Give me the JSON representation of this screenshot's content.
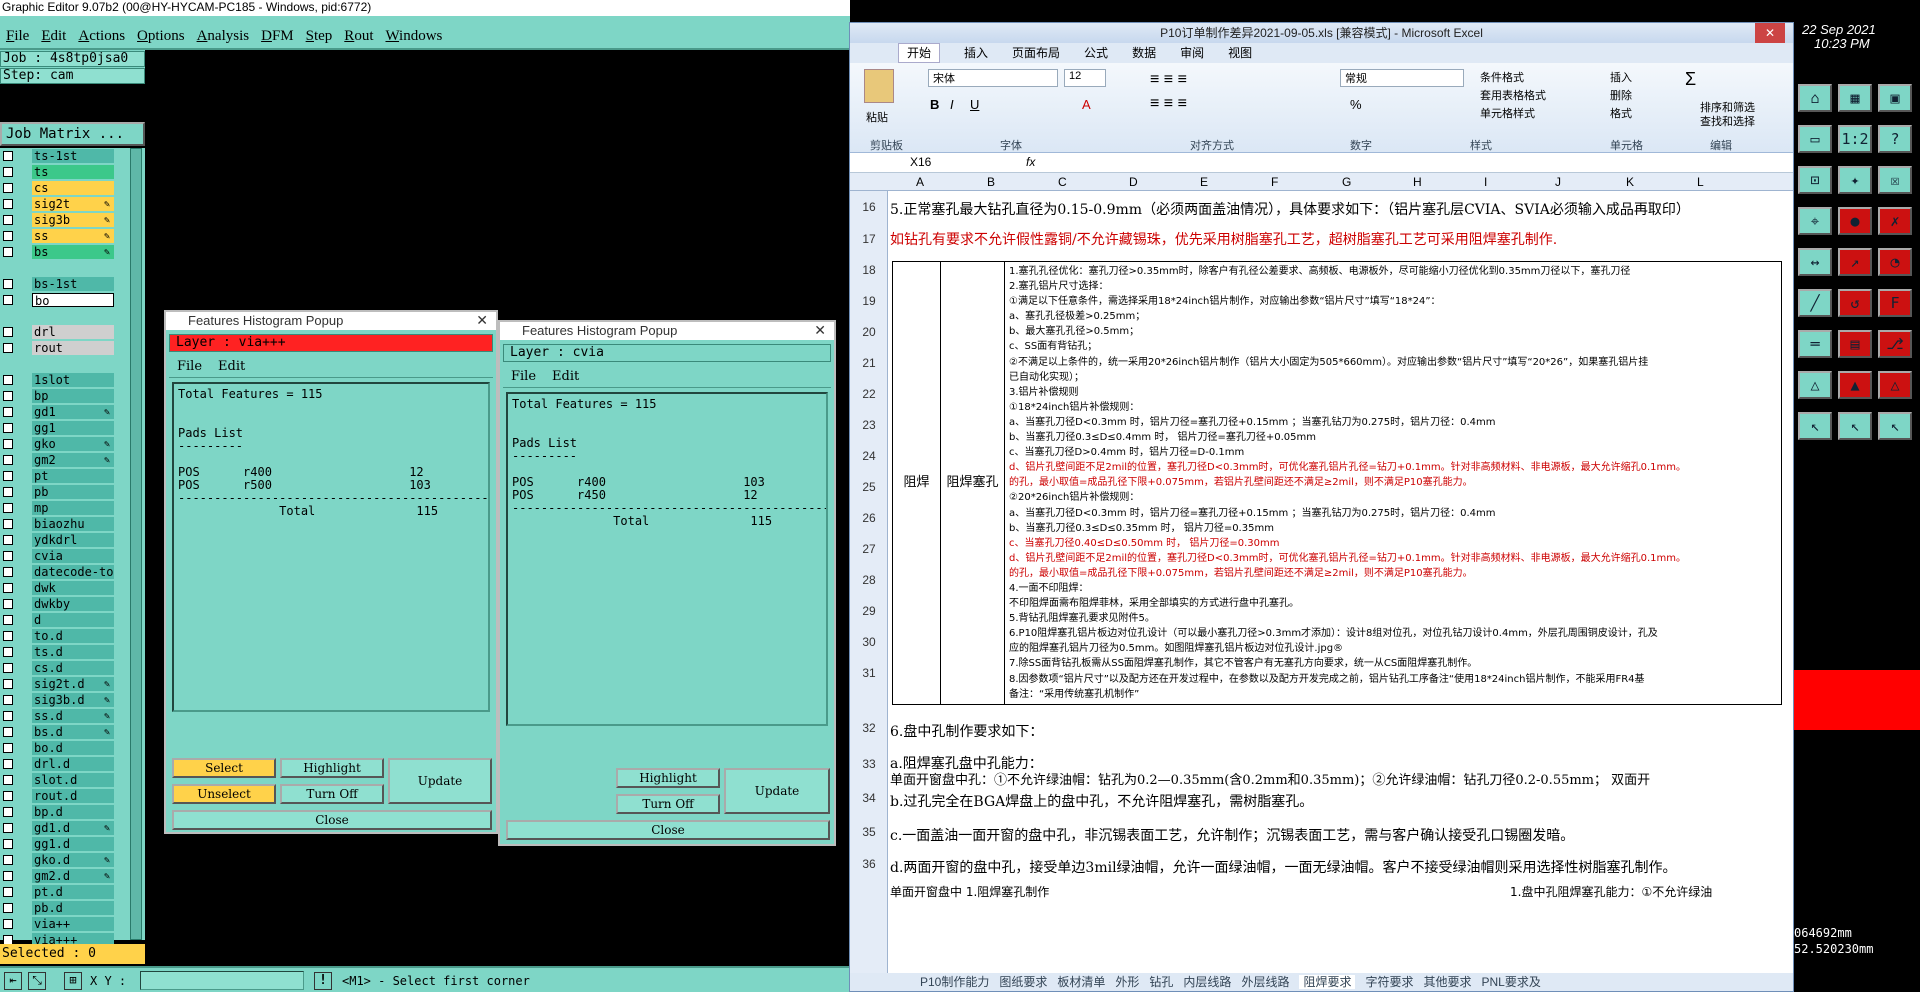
{
  "app": {
    "title": "Graphic Editor 9.07b2 (00@HY-HYCAM-PC185 - Windows, pid:6772)",
    "menu": [
      "File",
      "Edit",
      "Actions",
      "Options",
      "Analysis",
      "DFM",
      "Step",
      "Rout",
      "Windows"
    ],
    "job_label": "Job : 4s8tp0jsa0",
    "step_label": "Step: cam",
    "job_matrix": "Job Matrix ...",
    "selected": "Selected : 0",
    "xy_label": "X Y :",
    "status_msg": "<M1> - Select first corner",
    "coord1": "064692mm",
    "coord2": "52.520230mm",
    "date": "22 Sep 2021",
    "time": "10:23 PM"
  },
  "layers": [
    {
      "name": "ts-1st",
      "style": "teal2"
    },
    {
      "name": "ts",
      "style": "green"
    },
    {
      "name": "cs",
      "style": "yellow"
    },
    {
      "name": "sig2t",
      "style": "yellow",
      "flag": "✎"
    },
    {
      "name": "sig3b",
      "style": "yellow",
      "flag": "✎"
    },
    {
      "name": "ss",
      "style": "yellow",
      "flag": "✎"
    },
    {
      "name": "bs",
      "style": "green",
      "flag": "✎"
    },
    {
      "name": "",
      "style": "none"
    },
    {
      "name": "bs-1st",
      "style": "teal2"
    },
    {
      "name": "bo",
      "style": "white"
    },
    {
      "name": "",
      "style": "none"
    },
    {
      "name": "drl",
      "style": "gray"
    },
    {
      "name": "rout",
      "style": "gray"
    },
    {
      "name": "",
      "style": "none"
    },
    {
      "name": "1slot",
      "style": "teal2"
    },
    {
      "name": "bp",
      "style": "teal2"
    },
    {
      "name": "gd1",
      "style": "teal2",
      "flag": "✎"
    },
    {
      "name": "gg1",
      "style": "teal2"
    },
    {
      "name": "gko",
      "style": "teal2",
      "flag": "✎"
    },
    {
      "name": "gm2",
      "style": "teal2",
      "flag": "✎"
    },
    {
      "name": "pt",
      "style": "teal2"
    },
    {
      "name": "pb",
      "style": "teal2"
    },
    {
      "name": "mp",
      "style": "teal2"
    },
    {
      "name": "biaozhu",
      "style": "teal2"
    },
    {
      "name": "ydkdrl",
      "style": "teal2"
    },
    {
      "name": "cvia",
      "style": "teal2"
    },
    {
      "name": "datecode-to",
      "style": "teal2"
    },
    {
      "name": "dwk",
      "style": "teal2"
    },
    {
      "name": "dwkby",
      "style": "teal2"
    },
    {
      "name": "d",
      "style": "teal2"
    },
    {
      "name": "to.d",
      "style": "teal2"
    },
    {
      "name": "ts.d",
      "style": "teal2"
    },
    {
      "name": "cs.d",
      "style": "teal2"
    },
    {
      "name": "sig2t.d",
      "style": "teal2",
      "flag": "✎"
    },
    {
      "name": "sig3b.d",
      "style": "teal2",
      "flag": "✎"
    },
    {
      "name": "ss.d",
      "style": "teal2",
      "flag": "✎"
    },
    {
      "name": "bs.d",
      "style": "teal2",
      "flag": "✎"
    },
    {
      "name": "bo.d",
      "style": "teal2"
    },
    {
      "name": "drl.d",
      "style": "teal2"
    },
    {
      "name": "slot.d",
      "style": "teal2"
    },
    {
      "name": "rout.d",
      "style": "teal2"
    },
    {
      "name": "bp.d",
      "style": "teal2"
    },
    {
      "name": "gd1.d",
      "style": "teal2",
      "flag": "✎"
    },
    {
      "name": "gg1.d",
      "style": "teal2"
    },
    {
      "name": "gko.d",
      "style": "teal2",
      "flag": "✎"
    },
    {
      "name": "gm2.d",
      "style": "teal2",
      "flag": "✎"
    },
    {
      "name": "pt.d",
      "style": "teal2"
    },
    {
      "name": "pb.d",
      "style": "teal2"
    },
    {
      "name": "via++",
      "style": "teal2"
    },
    {
      "name": "via+++",
      "style": "teal2"
    }
  ],
  "popup1": {
    "title": "Features Histogram Popup",
    "layer": "Layer :  via+++",
    "menu": [
      "File",
      "Edit"
    ],
    "text": "Total Features = 115\n\n\nPads List\n---------\n\nPOS      r400                   12\nPOS      r500                   103\n-----------------------------------------------\n              Total              115",
    "select": "Select",
    "unselect": "Unselect",
    "highlight": "Highlight",
    "turn_off": "Turn Off",
    "update": "Update",
    "close": "Close"
  },
  "popup2": {
    "title": "Features Histogram Popup",
    "layer": "Layer :  cvia",
    "menu": [
      "File",
      "Edit"
    ],
    "text": "Total Features = 115\n\n\nPads List\n---------\n\nPOS      r400                   103\nPOS      r450                   12\n-----------------------------------------------\n              Total              115",
    "highlight": "Highlight",
    "turn_off": "Turn Off",
    "update": "Update",
    "close": "Close"
  },
  "excel": {
    "title": "P10订单制作差异2021-09-05.xls  [兼容模式] - Microsoft Excel",
    "tabs": [
      "开始",
      "插入",
      "页面布局",
      "公式",
      "数据",
      "审阅",
      "视图"
    ],
    "font": "宋体",
    "size": "12",
    "numfmt": "常规",
    "groups": [
      "剪贴板",
      "字体",
      "对齐方式",
      "数字",
      "样式",
      "单元格",
      "编辑"
    ],
    "paste": "粘贴",
    "style_btns": [
      "条件格式",
      "套用表格格式",
      "单元格样式"
    ],
    "cell_btns": [
      "插入",
      "删除",
      "格式"
    ],
    "edit_btns": [
      "排序和筛选",
      "查找和选择"
    ],
    "namebox": "X16",
    "fx": "fx",
    "columns": [
      "A",
      "B",
      "C",
      "D",
      "E",
      "F",
      "G",
      "H",
      "I",
      "J",
      "K",
      "L"
    ],
    "rows": [
      {
        "n": "16",
        "text": "5.正常塞孔最大钻孔直径为0.15-0.9mm（必须两面盖油情况），具体要求如下：（铝片塞孔层CVIA、SVIA必须输入成品再取印）",
        "color": "#000"
      },
      {
        "n": "17",
        "text": "如钻孔有要求不允许假性露铜/不允许藏锡珠，优先采用树脂塞孔工艺，超树脂塞孔工艺可采用阻焊塞孔制作.",
        "color": "#c00"
      }
    ],
    "row_nums_block": [
      "18",
      "19",
      "20",
      "21",
      "22",
      "23",
      "24",
      "25",
      "26",
      "27",
      "28",
      "29",
      "30",
      "31"
    ],
    "block_a": "阻焊",
    "block_b": "阻焊塞孔",
    "block_lines": [
      {
        "t": "1.塞孔孔径优化：塞孔刀径>0.35mm时，除客户有孔径公差要求、高频板、电源板外，尽可能缩小刀径优化到0.35mm刀径以下，塞孔刀径",
        "c": "#000"
      },
      {
        "t": "2.塞孔铝片尺寸选择：",
        "c": "#000"
      },
      {
        "t": "①满足以下任意条件，需选择采用18*24inch铝片制作，对应输出参数“铝片尺寸”填写“18*24”：",
        "c": "#000"
      },
      {
        "t": "a、塞孔孔径极差>0.25mm；",
        "c": "#000"
      },
      {
        "t": "b、最大塞孔孔径>0.5mm；",
        "c": "#000"
      },
      {
        "t": "c、SS面有背钻孔；",
        "c": "#000"
      },
      {
        "t": "②不满足以上条件的，统一采用20*26inch铝片制作（铝片大小固定为505*660mm）。对应输出参数“铝片尺寸”填写“20*26”，如果塞孔铝片挂",
        "c": "#000"
      },
      {
        "t": "已自动化实现）；",
        "c": "#000"
      },
      {
        "t": "3.铝片补偿规则",
        "c": "#000"
      },
      {
        "t": "①18*24inch铝片补偿规则：",
        "c": "#000"
      },
      {
        "t": "a、当塞孔刀径D<0.3mm 时，铝片刀径=塞孔刀径+0.15mm ；当塞孔钻刀为0.275时，铝片刀径：0.4mm",
        "c": "#000"
      },
      {
        "t": "b、当塞孔刀径0.3≤D≤0.4mm 时，  铝片刀径=塞孔刀径+0.05mm",
        "c": "#000"
      },
      {
        "t": "c、当塞孔刀径D>0.4mm 时，铝片刀径=D-0.1mm",
        "c": "#000"
      },
      {
        "t": "d、铝片孔壁间距不足2mil的位置，塞孔刀径D<0.3mm时，可优化塞孔铝片孔径=钻刀+0.1mm。针对非高频材料、非电源板，最大允许缩孔0.1mm。",
        "c": "#c00"
      },
      {
        "t": "的孔，最小取值=成品孔径下限+0.075mm，若铝片孔壁间距还不满足≥2mil，则不满足P10塞孔能力。",
        "c": "#c00"
      },
      {
        "t": "②20*26inch铝片补偿规则：",
        "c": "#000"
      },
      {
        "t": "a、当塞孔刀径D<0.3mm 时，铝片刀径=塞孔刀径+0.15mm ；当塞孔钻刀为0.275时，铝片刀径：0.4mm",
        "c": "#000"
      },
      {
        "t": "b、当塞孔刀径0.3≤D≤0.35mm 时，  铝片刀径=0.35mm",
        "c": "#000"
      },
      {
        "t": "c、当塞孔刀径0.40≤D≤0.50mm 时，  铝片刀径=0.30mm",
        "c": "#c00"
      },
      {
        "t": "d、铝片孔壁间距不足2mil的位置，塞孔刀径D<0.3mm时，可优化塞孔铝片孔径=钻刀+0.1mm。针对非高频材料、非电源板，最大允许缩孔0.1mm。",
        "c": "#c00"
      },
      {
        "t": "的孔，最小取值=成品孔径下限+0.075mm，若铝片孔壁间距还不满足≥2mil，则不满足P10塞孔能力。",
        "c": "#c00"
      },
      {
        "t": "4.一面不印阻焊：",
        "c": "#000"
      },
      {
        "t": "不印阻焊面需布阻焊菲林，采用全部填实的方式进行盘中孔塞孔。",
        "c": "#000"
      },
      {
        "t": "5.背钻孔阻焊塞孔要求见附件5。",
        "c": "#000"
      },
      {
        "t": "6.P10阻焊塞孔铝片板边对位孔设计（可以最小塞孔刀径>0.3mm才添加）：设计8组对位孔，对位孔钻刀设计0.4mm，外层孔周围铜皮设计，孔及",
        "c": "#000"
      },
      {
        "t": "应的阻焊塞孔铝片刀径为0.5mm。如图阻焊塞孔铝片板边对位孔设计.jpg®",
        "c": "#000"
      },
      {
        "t": "7.除SS面背钻孔板需从SS面阻焊塞孔制作，其它不管客户有无塞孔方向要求，统一从CS面阻焊塞孔制作。",
        "c": "#000"
      },
      {
        "t": "8.因参数项“铝片尺寸”以及配方还在开发过程中，在参数以及配方开发完成之前，铝片钻孔工序备注“使用18*24inch铝片制作，不能采用FR4基",
        "c": "#000"
      },
      {
        "t": "备注：“采用传统塞孔机制作”",
        "c": "#000"
      }
    ],
    "rows_after": [
      {
        "n": "32",
        "text": "6.盘中孔制作要求如下："
      },
      {
        "n": "33",
        "text": "a.阻焊塞孔盘中孔能力：",
        "text2": "单面开窗盘中孔：①不允许绿油帽：钻孔为0.2—0.35mm(含0.2mm和0.35mm)；②允许绿油帽：钻孔刀径0.2-0.55mm；      双面开"
      },
      {
        "n": "34",
        "text": "b.过孔完全在BGA焊盘上的盘中孔，不允许阻焊塞孔，需树脂塞孔。"
      },
      {
        "n": "35",
        "text": "c.一面盖油一面开窗的盘中孔，非沉锡表面工艺，允许制作；沉锡表面工艺，需与客户确认接受孔口锡圈发暗。"
      },
      {
        "n": "36",
        "text": "d.两面开窗的盘中孔，接受单边3mil绿油帽，允许一面绿油帽，一面无绿油帽。客户不接受绿油帽则采用选择性树脂塞孔制作。"
      }
    ],
    "row37": "单面开窗盘中  1.阻焊塞孔制作",
    "row37_right": "1.盘中孔阻焊塞孔能力：①不允许绿油",
    "sheets": [
      "P10制作能力",
      "图纸要求",
      "板材清单",
      "外形",
      "钻孔",
      "内层线路",
      "外层线路",
      "阻焊要求",
      "字符要求",
      "其他要求",
      "PNL要求及"
    ]
  },
  "toolbox": {
    "buttons": [
      "⌂",
      "▦",
      "▣",
      "▭",
      "1:2",
      "?",
      "⊡",
      "✦",
      "☒",
      "⌖",
      "●",
      "✗",
      "↔",
      "↗",
      "◔",
      "╱",
      "↺",
      "F",
      "═",
      "▤",
      "⎇",
      "△",
      "▲",
      "△",
      "↖",
      "↖",
      "↖"
    ]
  }
}
